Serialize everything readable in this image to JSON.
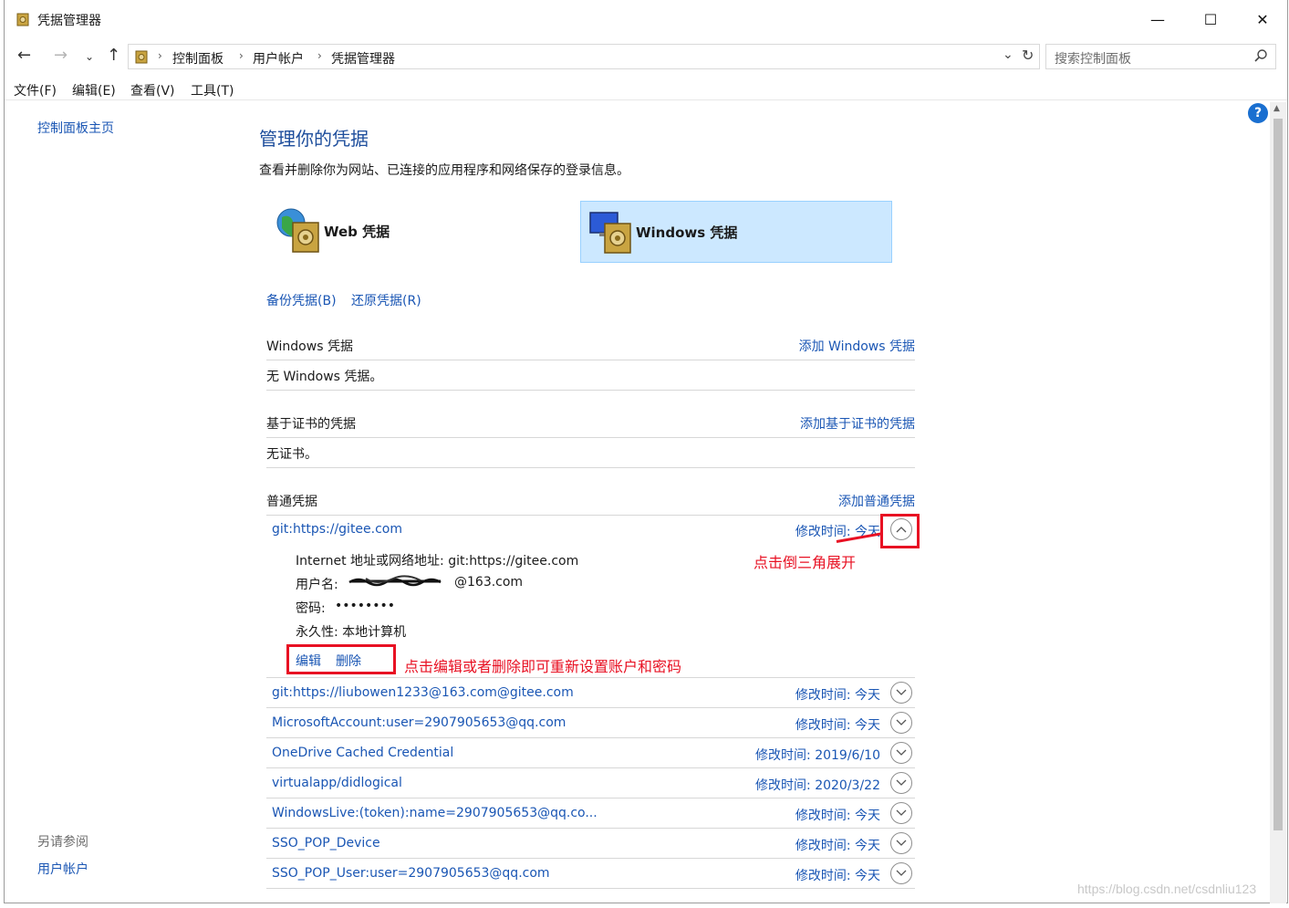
{
  "window": {
    "title": "凭据管理器",
    "controls": {
      "minimize": "—",
      "maximize": "☐",
      "close": "✕"
    }
  },
  "nav": {
    "back": "←",
    "forward": "→",
    "recent": "⌄",
    "up": "↑",
    "breadcrumb": [
      "控制面板",
      "用户帐户",
      "凭据管理器"
    ],
    "search_placeholder": "搜索控制面板"
  },
  "menu": [
    "文件(F)",
    "编辑(E)",
    "查看(V)",
    "工具(T)"
  ],
  "sidebar": {
    "home": "控制面板主页",
    "see_also": "另请参阅",
    "user_accounts": "用户帐户"
  },
  "main": {
    "title": "管理你的凭据",
    "description": "查看并删除你为网站、已连接的应用程序和网络保存的登录信息。",
    "tiles": {
      "web": "Web 凭据",
      "windows": "Windows 凭据"
    },
    "backup": "备份凭据(B)",
    "restore": "还原凭据(R)",
    "sections": {
      "windows": {
        "heading": "Windows 凭据",
        "add": "添加 Windows 凭据",
        "empty": "无 Windows 凭据。"
      },
      "cert": {
        "heading": "基于证书的凭据",
        "add": "添加基于证书的凭据",
        "empty": "无证书。"
      },
      "generic": {
        "heading": "普通凭据",
        "add": "添加普通凭据"
      }
    },
    "expanded": {
      "name": "git:https://gitee.com",
      "modified": "修改时间:  今天",
      "address": "Internet 地址或网络地址:  git:https://gitee.com",
      "username_label": "用户名:",
      "username_visible": "@163.com",
      "password_label": "密码:",
      "password_mask": "••••••••",
      "persistence": "永久性:  本地计算机",
      "edit": "编辑",
      "delete": "删除"
    },
    "credentials": [
      {
        "name": "git:https://liubowen1233@163.com@gitee.com",
        "modified": "修改时间:  今天"
      },
      {
        "name": "MicrosoftAccount:user=2907905653@qq.com",
        "modified": "修改时间:  今天"
      },
      {
        "name": "OneDrive Cached Credential",
        "modified": "修改时间:  2019/6/10"
      },
      {
        "name": "virtualapp/didlogical",
        "modified": "修改时间:  2020/3/22"
      },
      {
        "name": "WindowsLive:(token):name=2907905653@qq.co...",
        "modified": "修改时间:  今天"
      },
      {
        "name": "SSO_POP_Device",
        "modified": "修改时间:  今天"
      },
      {
        "name": "SSO_POP_User:user=2907905653@qq.com",
        "modified": "修改时间:  今天"
      }
    ]
  },
  "annotations": {
    "expand_hint": "点击倒三角展开",
    "edit_hint": "点击编辑或者删除即可重新设置账户和密码",
    "color": "#e81123"
  },
  "help": "?",
  "watermark": "https://blog.csdn.net/csdnliu123"
}
